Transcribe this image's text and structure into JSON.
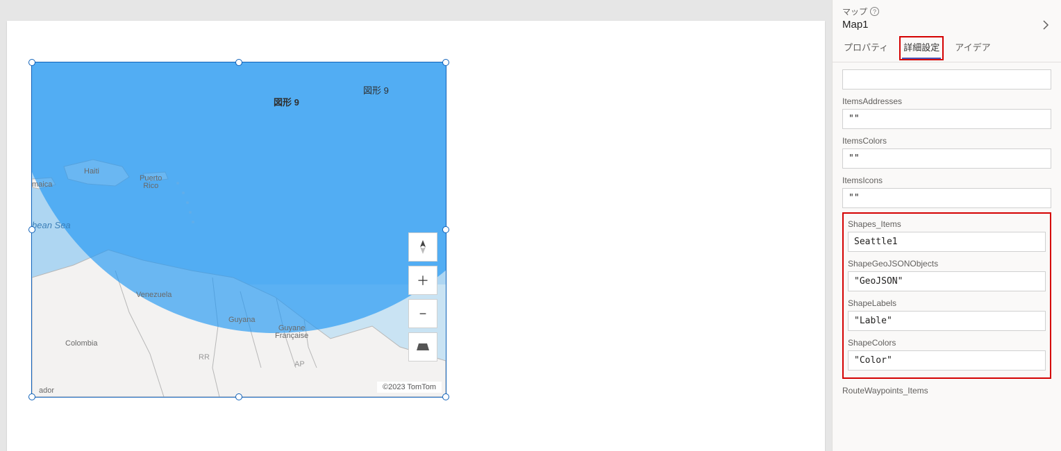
{
  "panel": {
    "type_label": "マップ",
    "name": "Map1",
    "tabs": {
      "properties": "プロパティ",
      "advanced": "詳細設定",
      "ideas": "アイデア"
    }
  },
  "props": {
    "itemsAddresses": {
      "label": "ItemsAddresses",
      "value": "\"\""
    },
    "itemsColors": {
      "label": "ItemsColors",
      "value": "\"\""
    },
    "itemsIcons": {
      "label": "ItemsIcons",
      "value": "\"\""
    },
    "shapesItems": {
      "label": "Shapes_Items",
      "value": "Seattle1"
    },
    "shapeGeoJSON": {
      "label": "ShapeGeoJSONObjects",
      "value": "\"GeoJSON\""
    },
    "shapeLabels": {
      "label": "ShapeLabels",
      "value": "\"Lable\""
    },
    "shapeColors": {
      "label": "ShapeColors",
      "value": "\"Color\""
    },
    "routeWaypoints": {
      "label": "RouteWaypoints_Items"
    }
  },
  "map": {
    "shape_label_a": "図形 9",
    "shape_label_b": "図形 9",
    "attribution": "©2023 TomTom",
    "places": {
      "haiti": "Haiti",
      "puerto_rico": "Puerto Rico",
      "maica": "maica",
      "bean_sea": "bean Sea",
      "venezuela": "Venezuela",
      "colombia": "Colombia",
      "rr": "RR",
      "ap": "AP",
      "guyana": "Guyana",
      "guyane": "Guyane\nFrançaise",
      "ador": "ador"
    },
    "controls": {
      "compass": "◆",
      "zoom_in": "＋",
      "zoom_out": "−",
      "pitch": "▰"
    }
  }
}
